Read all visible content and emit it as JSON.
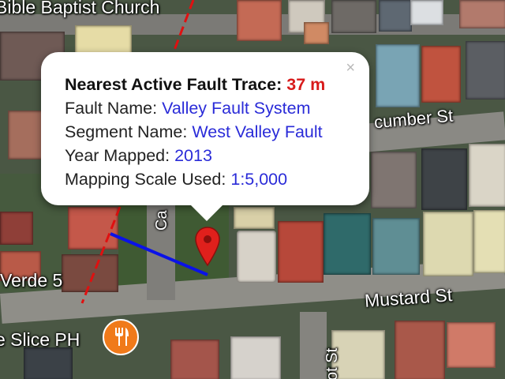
{
  "popup": {
    "title_label": "Nearest Active Fault Trace:",
    "distance": "37 m",
    "rows": [
      {
        "key": "Fault Name:",
        "value": "Valley Fault System"
      },
      {
        "key": "Segment Name:",
        "value": "West Valley Fault"
      },
      {
        "key": "Year Mapped:",
        "value": "2013"
      },
      {
        "key": "Mapping Scale Used:",
        "value": "1:5,000"
      }
    ],
    "close_glyph": "×"
  },
  "map_labels": {
    "church": "Bible Baptist Church",
    "cucumber_st": "cumber St",
    "mustard_st": "Mustard St",
    "verde": "Verde 5",
    "slice": "e Slice PH",
    "ca_st": "Ca",
    "bottom_st": "ot St"
  },
  "icons": {
    "food_icon": "fork-knife-icon",
    "marker_icon": "location-pin-icon"
  },
  "colors": {
    "distance": "#d81b1b",
    "value_text": "#2a2bd8",
    "fault_trace": "#e01010",
    "connector": "#0a12e8",
    "pin": "#e0201c",
    "food_badge": "#f07a1a"
  }
}
